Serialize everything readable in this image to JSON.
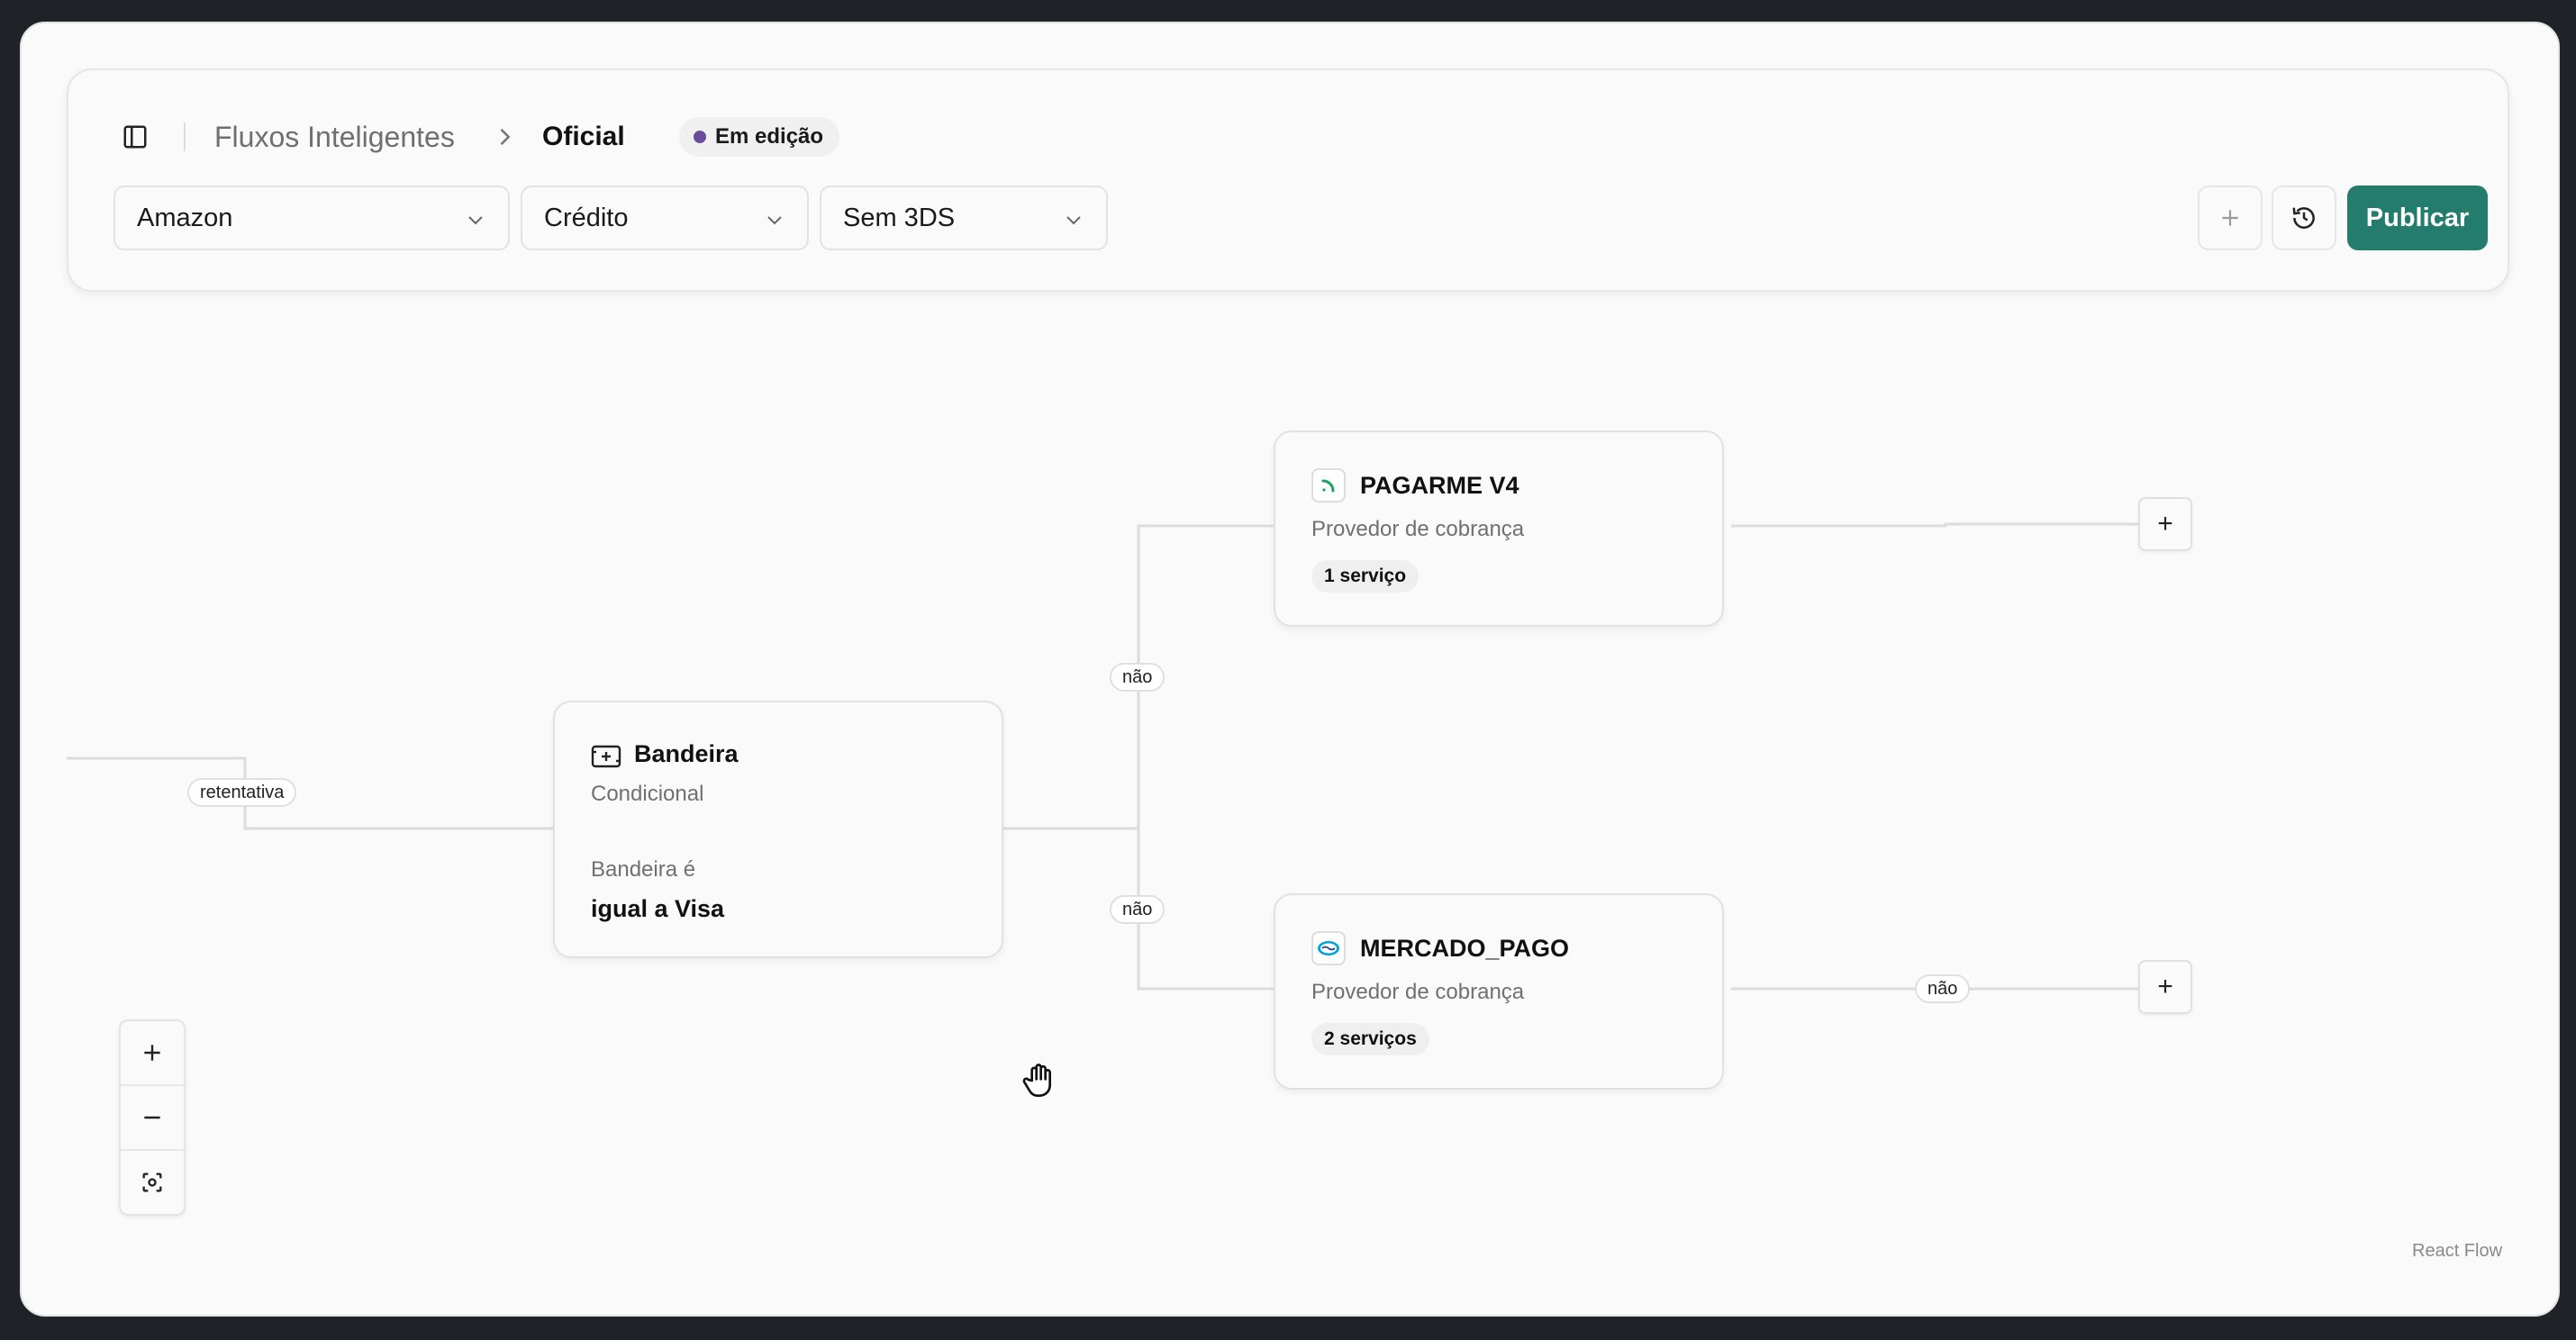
{
  "header": {
    "breadcrumb_parent": "Fluxos Inteligentes",
    "breadcrumb_current": "Oficial",
    "status": "Em edição",
    "filters": {
      "merchant": "Amazon",
      "payment_method": "Crédito",
      "three_ds": "Sem 3DS"
    },
    "publish_label": "Publicar"
  },
  "nodes": {
    "condition": {
      "title": "Bandeira",
      "type": "Condicional",
      "rule_label": "Bandeira é",
      "rule_value": "igual a Visa"
    },
    "provider_top": {
      "title": "PAGARME V4",
      "type": "Provedor de cobrança",
      "services": "1 serviço"
    },
    "provider_bottom": {
      "title": "MERCADO_PAGO",
      "type": "Provedor de cobrança",
      "services": "2 serviços"
    }
  },
  "edges": {
    "retry": "retentativa",
    "no_top": "não",
    "no_bottom": "não",
    "no_right": "não"
  },
  "controls": {
    "zoom_in": "+",
    "add": "+"
  },
  "attribution": "React Flow",
  "colors": {
    "primary": "#237c6c",
    "status_dot": "#6b4c9a",
    "pagarme": "#1aa35c",
    "mercadopago": "#00a3e0"
  },
  "icons": [
    "sidebar-toggle-icon",
    "chevron-right-icon",
    "chevron-down-icon",
    "plus-icon",
    "history-icon",
    "card-icon",
    "pagarme-logo",
    "mercadopago-logo",
    "minus-icon",
    "fit-view-icon",
    "hand-cursor-icon"
  ]
}
